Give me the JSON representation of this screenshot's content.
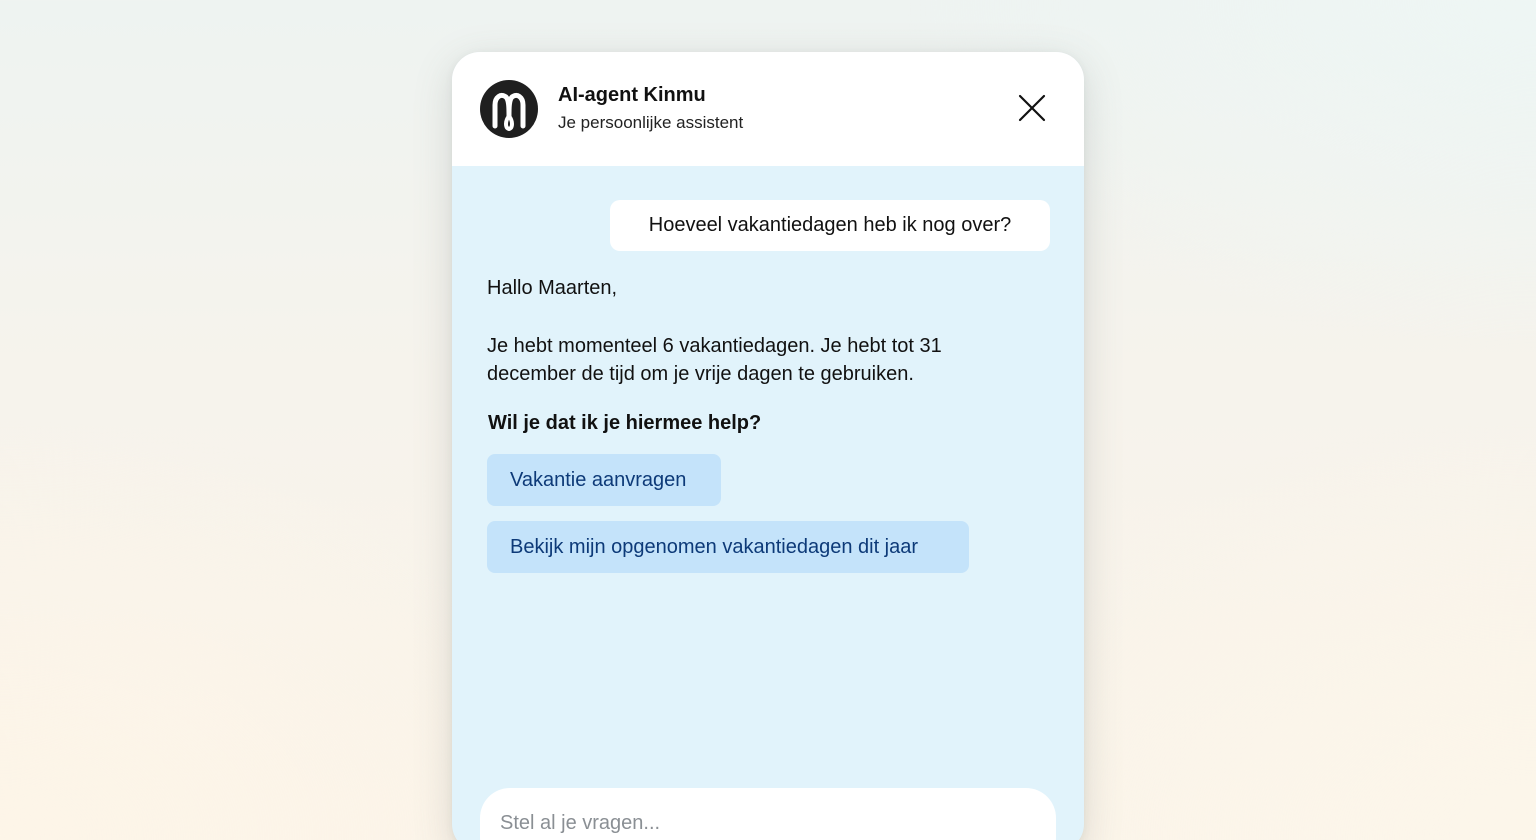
{
  "header": {
    "title": "AI-agent Kinmu",
    "subtitle": "Je persoonlijke assistent",
    "logo_icon": "kinmu-logo-icon",
    "close_icon": "close-icon"
  },
  "conversation": {
    "user_message": "Hoeveel vakantiedagen heb ik nog over?",
    "agent_greeting": "Hallo Maarten,",
    "agent_reply_lines": [
      "Je hebt momenteel 6 vakantiedagen. Je hebt tot 31",
      "december de tijd om je vrije dagen te gebruiken."
    ],
    "agent_question": "Wil je dat ik je hiermee help?",
    "suggestions": [
      "Vakantie aanvragen",
      "Bekijk mijn opgenomen vakantiedagen dit jaar"
    ]
  },
  "input": {
    "placeholder": "Stel al je vragen...",
    "value": ""
  },
  "colors": {
    "chat_background": "#e1f3fb",
    "suggestion_background": "#c4e3fa",
    "suggestion_text": "#0d3a78",
    "logo": "#1f1f1f"
  }
}
